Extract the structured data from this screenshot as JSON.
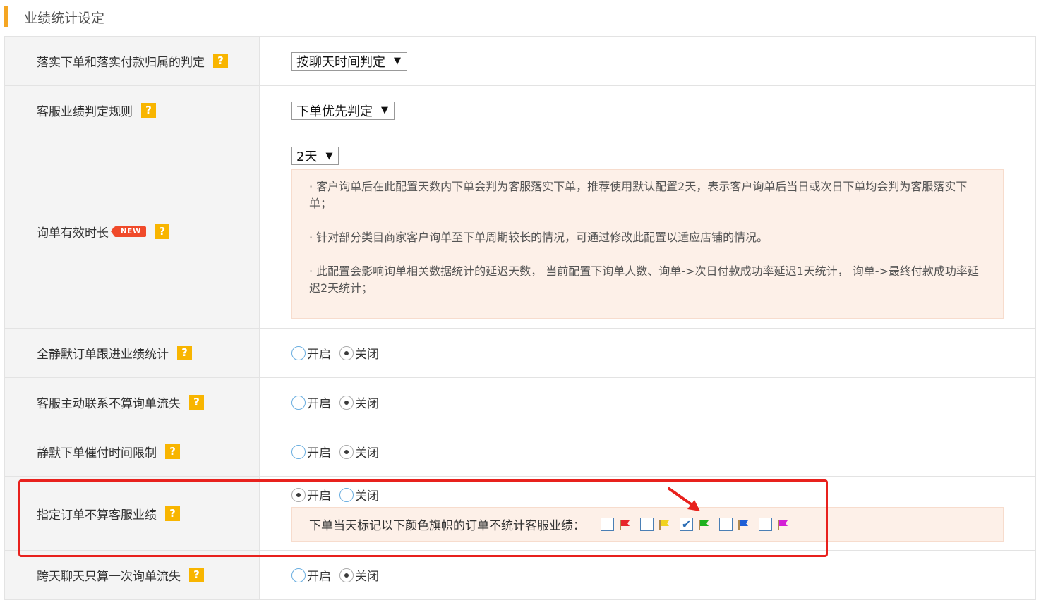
{
  "section": {
    "title": "业绩统计设定"
  },
  "icons": {
    "help": "?",
    "new_badge": "NEW",
    "dropdown_caret": "▼"
  },
  "rows": [
    {
      "label": "落实下单和落实付款归属的判定",
      "control": "select",
      "value": "按聊天时间判定"
    },
    {
      "label": "客服业绩判定规则",
      "control": "select",
      "value": "下单优先判定"
    },
    {
      "label": "询单有效时长",
      "badge": "NEW",
      "control": "select",
      "value": "2天",
      "notes": [
        "· 客户询单后在此配置天数内下单会判为客服落实下单，推荐使用默认配置2天，表示客户询单后当日或次日下单均会判为客服落实下单；",
        "· 针对部分类目商家客户询单至下单周期较长的情况，可通过修改此配置以适应店铺的情况。",
        "· 此配置会影响询单相关数据统计的延迟天数， 当前配置下询单人数、询单->次日付款成功率延迟1天统计， 询单->最终付款成功率延迟2天统计；"
      ]
    },
    {
      "label": "全静默订单跟进业绩统计",
      "control": "radio",
      "on_label": "开启",
      "off_label": "关闭",
      "selected": "off"
    },
    {
      "label": "客服主动联系不算询单流失",
      "control": "radio",
      "on_label": "开启",
      "off_label": "关闭",
      "selected": "off"
    },
    {
      "label": "静默下单催付时间限制",
      "control": "radio",
      "on_label": "开启",
      "off_label": "关闭",
      "selected": "off"
    },
    {
      "label": "指定订单不算客服业绩",
      "control": "radio",
      "on_label": "开启",
      "off_label": "关闭",
      "selected": "on",
      "flag_text": "下单当天标记以下颜色旗帜的订单不统计客服业绩：",
      "flags": [
        {
          "color": "red",
          "hex": "#e8262a",
          "checked": false
        },
        {
          "color": "yellow",
          "hex": "#f2d21e",
          "checked": false
        },
        {
          "color": "green",
          "hex": "#1fb21f",
          "checked": true
        },
        {
          "color": "blue",
          "hex": "#1f5fd6",
          "checked": false
        },
        {
          "color": "purple",
          "hex": "#d41fd6",
          "checked": false
        }
      ]
    },
    {
      "label": "跨天聊天只算一次询单流失",
      "control": "radio",
      "on_label": "开启",
      "off_label": "关闭",
      "selected": "off"
    }
  ],
  "colors": {
    "accent": "#f5a623",
    "help_icon": "#f8b500",
    "highlight_border": "#e8211d",
    "notice_bg": "#fdf0e8"
  }
}
